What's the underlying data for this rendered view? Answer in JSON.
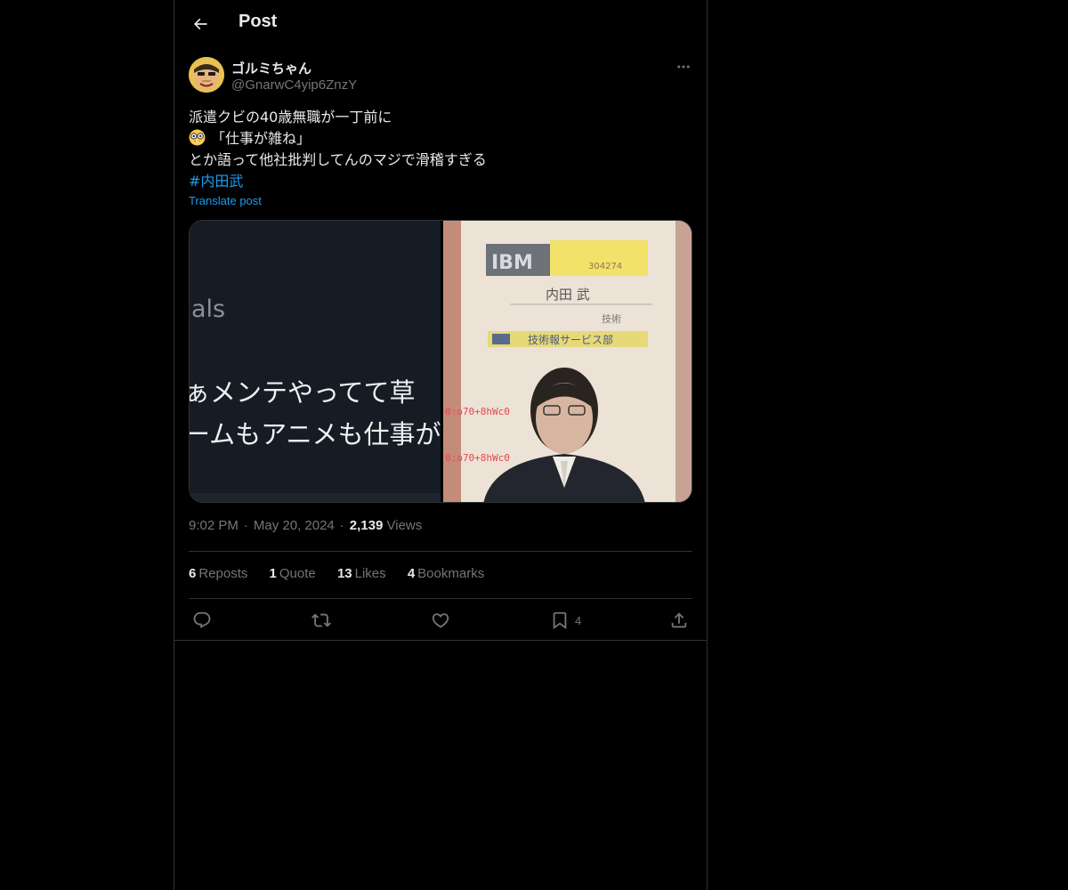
{
  "header": {
    "title": "Post",
    "back_icon": "arrow-left-icon"
  },
  "tweet": {
    "author": {
      "name": "ゴルミちゃん",
      "handle": "@GnarwC4yip6ZnzY"
    },
    "text_lines": [
      "派遣クビの40歳無職が一丁前に",
      "「仕事が雑ね」",
      "とか語って他社批判してんのマジで滑稽すぎる"
    ],
    "text_emoji": "nerd-face-icon",
    "hashtag": "#内田武",
    "translate_label": "Translate post",
    "media": {
      "left_panel": {
        "text_top": "als",
        "text_line1": "ぁメンテやってて草",
        "text_line2": "ームもアニメも仕事が"
      },
      "right_panel": {
        "logo_text": "IBM",
        "card_number": "304274",
        "name_text": "内田 武",
        "dept_text": "技術報サービス部",
        "sub_text": "技術",
        "watermark1": "0:o70+8hWc0",
        "watermark2": "0:o70+8hWc0"
      }
    },
    "time": "9:02 PM",
    "date": "May 20, 2024",
    "views_count": "2,139",
    "views_label": "Views",
    "stats": {
      "reposts_count": "6",
      "reposts_label": "Reposts",
      "quotes_count": "1",
      "quotes_label": "Quote",
      "likes_count": "13",
      "likes_label": "Likes",
      "bookmarks_count": "4",
      "bookmarks_label": "Bookmarks"
    },
    "actions": {
      "bookmark_count": "4"
    }
  },
  "colors": {
    "background": "#000000",
    "text": "#e7e9ea",
    "muted": "#71767b",
    "accent": "#1d9bf0",
    "border": "#2f3336"
  }
}
